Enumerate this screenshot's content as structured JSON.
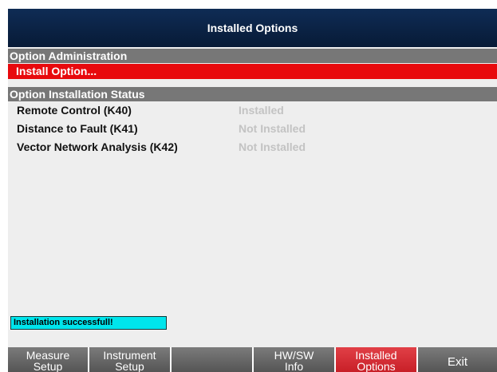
{
  "window": {
    "title": "Installed Options"
  },
  "sections": {
    "administration": "Option Administration",
    "status": "Option Installation Status"
  },
  "menu": {
    "install_option": "Install Option..."
  },
  "options": [
    {
      "name": "Remote Control (K40)",
      "status": "Installed"
    },
    {
      "name": "Distance to Fault (K41)",
      "status": "Not Installed"
    },
    {
      "name": "Vector Network Analysis (K42)",
      "status": "Not Installed"
    }
  ],
  "message": "Installation successfull!",
  "softkeys": [
    {
      "line1": "Measure",
      "line2": "Setup"
    },
    {
      "line1": "Instrument",
      "line2": "Setup"
    },
    {
      "line1": "",
      "line2": ""
    },
    {
      "line1": "HW/SW",
      "line2": "Info"
    },
    {
      "line1": "Installed",
      "line2": "Options"
    },
    {
      "line1": "Exit",
      "line2": ""
    }
  ],
  "colors": {
    "title_bar": "#0f2c55",
    "selected": "#e8090d",
    "section": "#777777",
    "message_bg": "#00e5ec",
    "softkey_active": "#d62b33"
  }
}
